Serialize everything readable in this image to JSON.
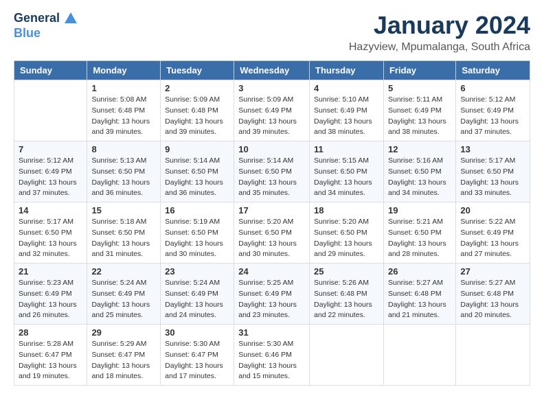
{
  "header": {
    "logo_line1": "General",
    "logo_line2": "Blue",
    "month": "January 2024",
    "location": "Hazyview, Mpumalanga, South Africa"
  },
  "weekdays": [
    "Sunday",
    "Monday",
    "Tuesday",
    "Wednesday",
    "Thursday",
    "Friday",
    "Saturday"
  ],
  "weeks": [
    [
      {
        "day": "",
        "info": ""
      },
      {
        "day": "1",
        "info": "Sunrise: 5:08 AM\nSunset: 6:48 PM\nDaylight: 13 hours\nand 39 minutes."
      },
      {
        "day": "2",
        "info": "Sunrise: 5:09 AM\nSunset: 6:48 PM\nDaylight: 13 hours\nand 39 minutes."
      },
      {
        "day": "3",
        "info": "Sunrise: 5:09 AM\nSunset: 6:49 PM\nDaylight: 13 hours\nand 39 minutes."
      },
      {
        "day": "4",
        "info": "Sunrise: 5:10 AM\nSunset: 6:49 PM\nDaylight: 13 hours\nand 38 minutes."
      },
      {
        "day": "5",
        "info": "Sunrise: 5:11 AM\nSunset: 6:49 PM\nDaylight: 13 hours\nand 38 minutes."
      },
      {
        "day": "6",
        "info": "Sunrise: 5:12 AM\nSunset: 6:49 PM\nDaylight: 13 hours\nand 37 minutes."
      }
    ],
    [
      {
        "day": "7",
        "info": "Sunrise: 5:12 AM\nSunset: 6:49 PM\nDaylight: 13 hours\nand 37 minutes."
      },
      {
        "day": "8",
        "info": "Sunrise: 5:13 AM\nSunset: 6:50 PM\nDaylight: 13 hours\nand 36 minutes."
      },
      {
        "day": "9",
        "info": "Sunrise: 5:14 AM\nSunset: 6:50 PM\nDaylight: 13 hours\nand 36 minutes."
      },
      {
        "day": "10",
        "info": "Sunrise: 5:14 AM\nSunset: 6:50 PM\nDaylight: 13 hours\nand 35 minutes."
      },
      {
        "day": "11",
        "info": "Sunrise: 5:15 AM\nSunset: 6:50 PM\nDaylight: 13 hours\nand 34 minutes."
      },
      {
        "day": "12",
        "info": "Sunrise: 5:16 AM\nSunset: 6:50 PM\nDaylight: 13 hours\nand 34 minutes."
      },
      {
        "day": "13",
        "info": "Sunrise: 5:17 AM\nSunset: 6:50 PM\nDaylight: 13 hours\nand 33 minutes."
      }
    ],
    [
      {
        "day": "14",
        "info": "Sunrise: 5:17 AM\nSunset: 6:50 PM\nDaylight: 13 hours\nand 32 minutes."
      },
      {
        "day": "15",
        "info": "Sunrise: 5:18 AM\nSunset: 6:50 PM\nDaylight: 13 hours\nand 31 minutes."
      },
      {
        "day": "16",
        "info": "Sunrise: 5:19 AM\nSunset: 6:50 PM\nDaylight: 13 hours\nand 30 minutes."
      },
      {
        "day": "17",
        "info": "Sunrise: 5:20 AM\nSunset: 6:50 PM\nDaylight: 13 hours\nand 30 minutes."
      },
      {
        "day": "18",
        "info": "Sunrise: 5:20 AM\nSunset: 6:50 PM\nDaylight: 13 hours\nand 29 minutes."
      },
      {
        "day": "19",
        "info": "Sunrise: 5:21 AM\nSunset: 6:50 PM\nDaylight: 13 hours\nand 28 minutes."
      },
      {
        "day": "20",
        "info": "Sunrise: 5:22 AM\nSunset: 6:49 PM\nDaylight: 13 hours\nand 27 minutes."
      }
    ],
    [
      {
        "day": "21",
        "info": "Sunrise: 5:23 AM\nSunset: 6:49 PM\nDaylight: 13 hours\nand 26 minutes."
      },
      {
        "day": "22",
        "info": "Sunrise: 5:24 AM\nSunset: 6:49 PM\nDaylight: 13 hours\nand 25 minutes."
      },
      {
        "day": "23",
        "info": "Sunrise: 5:24 AM\nSunset: 6:49 PM\nDaylight: 13 hours\nand 24 minutes."
      },
      {
        "day": "24",
        "info": "Sunrise: 5:25 AM\nSunset: 6:49 PM\nDaylight: 13 hours\nand 23 minutes."
      },
      {
        "day": "25",
        "info": "Sunrise: 5:26 AM\nSunset: 6:48 PM\nDaylight: 13 hours\nand 22 minutes."
      },
      {
        "day": "26",
        "info": "Sunrise: 5:27 AM\nSunset: 6:48 PM\nDaylight: 13 hours\nand 21 minutes."
      },
      {
        "day": "27",
        "info": "Sunrise: 5:27 AM\nSunset: 6:48 PM\nDaylight: 13 hours\nand 20 minutes."
      }
    ],
    [
      {
        "day": "28",
        "info": "Sunrise: 5:28 AM\nSunset: 6:47 PM\nDaylight: 13 hours\nand 19 minutes."
      },
      {
        "day": "29",
        "info": "Sunrise: 5:29 AM\nSunset: 6:47 PM\nDaylight: 13 hours\nand 18 minutes."
      },
      {
        "day": "30",
        "info": "Sunrise: 5:30 AM\nSunset: 6:47 PM\nDaylight: 13 hours\nand 17 minutes."
      },
      {
        "day": "31",
        "info": "Sunrise: 5:30 AM\nSunset: 6:46 PM\nDaylight: 13 hours\nand 15 minutes."
      },
      {
        "day": "",
        "info": ""
      },
      {
        "day": "",
        "info": ""
      },
      {
        "day": "",
        "info": ""
      }
    ]
  ]
}
